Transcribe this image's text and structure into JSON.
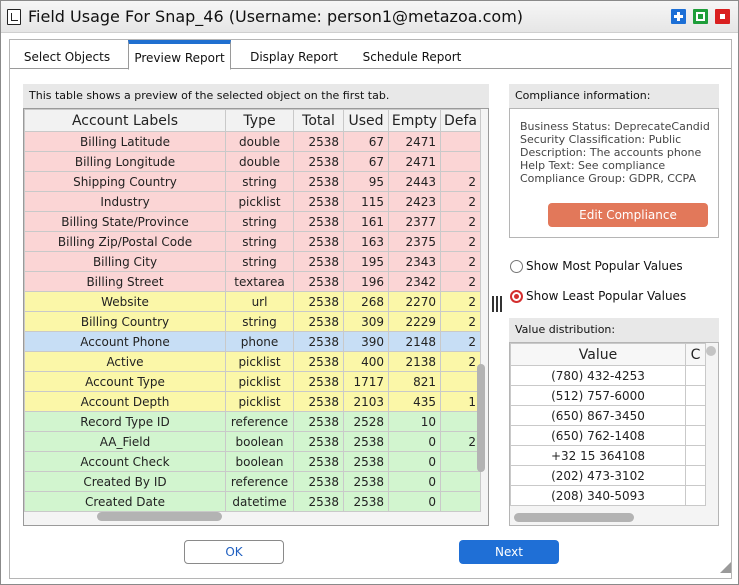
{
  "window": {
    "title": "Field Usage For Snap_46 (Username: person1@metazoa.com)",
    "controls": {
      "maximize": "maximize-icon",
      "restore": "restore-icon",
      "close": "close-icon"
    }
  },
  "tabs": [
    {
      "label": "Select Objects",
      "active": false
    },
    {
      "label": "Preview Report",
      "active": true
    },
    {
      "label": "Display Report",
      "active": false
    },
    {
      "label": "Schedule Report",
      "active": false
    }
  ],
  "preview": {
    "header": "This table shows a preview of the selected object on the first tab.",
    "columns": [
      "Account Labels",
      "Type",
      "Total",
      "Used",
      "Empty",
      "Defa"
    ],
    "rows": [
      {
        "label": "Billing Latitude",
        "type": "double",
        "total": "2538",
        "used": "67",
        "empty": "2471",
        "def": "",
        "color": "red"
      },
      {
        "label": "Billing Longitude",
        "type": "double",
        "total": "2538",
        "used": "67",
        "empty": "2471",
        "def": "",
        "color": "red"
      },
      {
        "label": "Shipping Country",
        "type": "string",
        "total": "2538",
        "used": "95",
        "empty": "2443",
        "def": "2",
        "color": "red"
      },
      {
        "label": "Industry",
        "type": "picklist",
        "total": "2538",
        "used": "115",
        "empty": "2423",
        "def": "2",
        "color": "red"
      },
      {
        "label": "Billing State/Province",
        "type": "string",
        "total": "2538",
        "used": "161",
        "empty": "2377",
        "def": "2",
        "color": "red"
      },
      {
        "label": "Billing Zip/Postal Code",
        "type": "string",
        "total": "2538",
        "used": "163",
        "empty": "2375",
        "def": "2",
        "color": "red"
      },
      {
        "label": "Billing City",
        "type": "string",
        "total": "2538",
        "used": "195",
        "empty": "2343",
        "def": "2",
        "color": "red"
      },
      {
        "label": "Billing Street",
        "type": "textarea",
        "total": "2538",
        "used": "196",
        "empty": "2342",
        "def": "2",
        "color": "red"
      },
      {
        "label": "Website",
        "type": "url",
        "total": "2538",
        "used": "268",
        "empty": "2270",
        "def": "2",
        "color": "yellow"
      },
      {
        "label": "Billing Country",
        "type": "string",
        "total": "2538",
        "used": "309",
        "empty": "2229",
        "def": "2",
        "color": "yellow"
      },
      {
        "label": "Account Phone",
        "type": "phone",
        "total": "2538",
        "used": "390",
        "empty": "2148",
        "def": "2",
        "color": "blue"
      },
      {
        "label": "Active",
        "type": "picklist",
        "total": "2538",
        "used": "400",
        "empty": "2138",
        "def": "2",
        "color": "yellow"
      },
      {
        "label": "Account Type",
        "type": "picklist",
        "total": "2538",
        "used": "1717",
        "empty": "821",
        "def": "",
        "color": "yellow"
      },
      {
        "label": "Account Depth",
        "type": "picklist",
        "total": "2538",
        "used": "2103",
        "empty": "435",
        "def": "1",
        "color": "yellow"
      },
      {
        "label": "Record Type ID",
        "type": "reference",
        "total": "2538",
        "used": "2528",
        "empty": "10",
        "def": "",
        "color": "green"
      },
      {
        "label": "AA_Field",
        "type": "boolean",
        "total": "2538",
        "used": "2538",
        "empty": "0",
        "def": "2",
        "color": "green"
      },
      {
        "label": "Account Check",
        "type": "boolean",
        "total": "2538",
        "used": "2538",
        "empty": "0",
        "def": "",
        "color": "green"
      },
      {
        "label": "Created By ID",
        "type": "reference",
        "total": "2538",
        "used": "2538",
        "empty": "0",
        "def": "",
        "color": "green"
      },
      {
        "label": "Created Date",
        "type": "datetime",
        "total": "2538",
        "used": "2538",
        "empty": "0",
        "def": "",
        "color": "green"
      }
    ]
  },
  "compliance": {
    "header": "Compliance information:",
    "lines": [
      "Business Status: DeprecateCandid",
      "Security Classification: Public",
      "Description: The accounts phone",
      "Help Text: See compliance",
      "Compliance Group: GDPR, CCPA"
    ],
    "edit_button": "Edit Compliance"
  },
  "options": {
    "most_popular": {
      "label": "Show Most Popular Values",
      "checked": false
    },
    "least_popular": {
      "label": "Show Least Popular Values",
      "checked": true
    }
  },
  "distribution": {
    "header": "Value distribution:",
    "columns": [
      "Value",
      "C"
    ],
    "values": [
      "(780) 432-4253",
      "(512) 757-6000",
      "(650) 867-3450",
      "(650) 762-1408",
      "+32 15 364108",
      "(202) 473-3102",
      "(208) 340-5093"
    ]
  },
  "footer": {
    "ok": "OK",
    "next": "Next"
  },
  "colors": {
    "accent": "#1f6fd6",
    "edit": "#e2785a",
    "red_row": "#fbd5d5",
    "yellow_row": "#fbf7a8",
    "blue_row": "#c7def5",
    "green_row": "#d2f5cf"
  }
}
